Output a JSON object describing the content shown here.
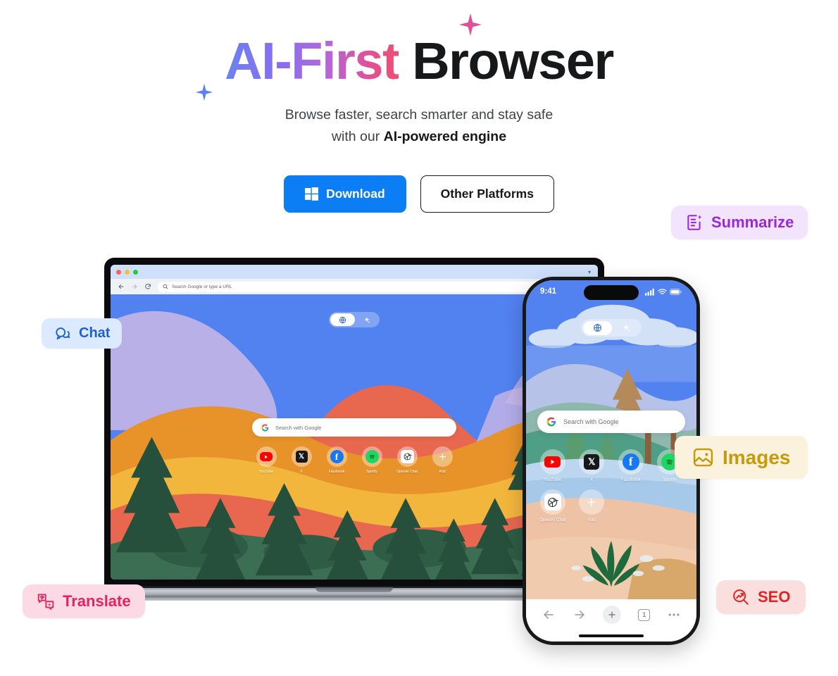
{
  "hero": {
    "headline_gradient": "AI-First",
    "headline_plain": " Browser",
    "subtitle_line1": "Browse faster, search smarter and stay safe",
    "subtitle_line2_prefix": "with our ",
    "subtitle_line2_bold": "AI-powered engine",
    "download_label": "Download",
    "other_platforms_label": "Other Platforms",
    "download_bg": "#0b7ef5",
    "sparkle_pink": "#e0509a",
    "sparkle_blue": "#5a82f0"
  },
  "badges": [
    {
      "id": "summarize",
      "label": "Summarize",
      "icon": "summarize-icon",
      "bg": "#f3e4fd",
      "fg": "#9c27d6"
    },
    {
      "id": "chat",
      "label": "Chat",
      "icon": "chat-bubbles-icon",
      "bg": "#dbeafe",
      "fg": "#1f5fd0"
    },
    {
      "id": "images",
      "label": "Images",
      "icon": "image-icon",
      "bg": "#faf2dc",
      "fg": "#c79a0b"
    },
    {
      "id": "translate",
      "label": "Translate",
      "icon": "translate-icon",
      "bg": "#fbdae6",
      "fg": "#e0245e"
    },
    {
      "id": "seo",
      "label": "SEO",
      "icon": "seo-trend-icon",
      "bg": "#fbdede",
      "fg": "#dc2626"
    }
  ],
  "laptop": {
    "omnibox_placeholder": "Search Google or type a URL",
    "search_placeholder": "Search with Google",
    "traffic_lights": [
      "close",
      "minimize",
      "maximize"
    ],
    "nav_icons": [
      "back-icon",
      "forward-icon",
      "reload-icon"
    ],
    "toggle": {
      "left_icon": "globe-icon",
      "right_icon": "sparkle-icon",
      "active": "globe"
    },
    "shortcuts": [
      {
        "name": "YouTube",
        "icon": "youtube-icon"
      },
      {
        "name": "X",
        "icon": "x-icon"
      },
      {
        "name": "Facebook",
        "icon": "facebook-icon"
      },
      {
        "name": "Spotify",
        "icon": "spotify-icon"
      },
      {
        "name": "OpenAI Chat",
        "icon": "openai-icon"
      },
      {
        "name": "Add",
        "icon": "plus-icon"
      }
    ]
  },
  "phone": {
    "status_time": "9:41",
    "status_icons": [
      "cellular-icon",
      "wifi-icon",
      "battery-icon"
    ],
    "search_placeholder": "Search with Google",
    "toggle": {
      "left_icon": "globe-icon",
      "right_icon": "sparkle-icon",
      "active": "globe"
    },
    "shortcuts": [
      {
        "name": "YouTube",
        "icon": "youtube-icon"
      },
      {
        "name": "X",
        "icon": "x-icon"
      },
      {
        "name": "Facebook",
        "icon": "facebook-icon"
      },
      {
        "name": "Spotify",
        "icon": "spotify-icon"
      },
      {
        "name": "OpenAI Chat",
        "icon": "openai-icon"
      },
      {
        "name": "Add",
        "icon": "plus-icon"
      }
    ],
    "toolbar": {
      "back": "back-icon",
      "forward": "forward-icon",
      "new_tab": "plus-icon",
      "tab_count": "1",
      "more": "more-icon"
    }
  },
  "wallpaper": {
    "sky": "#5282f0",
    "mountain_lavender": "#cbb8e6",
    "hill_orange": "#e8932a",
    "hill_yellow": "#f2b63d",
    "hill_red": "#e8684f",
    "forest_green": "#2f5c45",
    "tree_dark": "#27503c"
  }
}
